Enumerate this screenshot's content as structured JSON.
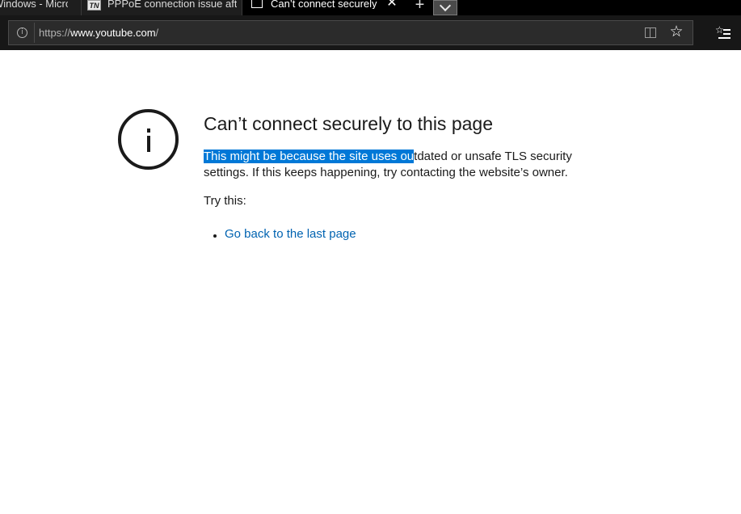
{
  "tabs": [
    {
      "label": "Windows - Micros"
    },
    {
      "label": "PPPoE connection issue afte",
      "favicon": "TN"
    },
    {
      "label": "Can’t connect securely t"
    }
  ],
  "toolbar": {
    "url_scheme": "https://",
    "url_host": "www.youtube.com",
    "url_path": "/"
  },
  "error": {
    "title": "Can’t connect securely to this page",
    "description_selected": "This might be because the site uses ou",
    "description_rest": "tdated or unsafe TLS security settings. If this keeps happening, try contacting the website’s owner.",
    "try_label": "Try this:",
    "suggestions": [
      {
        "label": "Go back to the last page"
      }
    ]
  },
  "colors": {
    "selection": "#0078d7",
    "link": "#0063b1",
    "chrome_bg": "#171717"
  }
}
